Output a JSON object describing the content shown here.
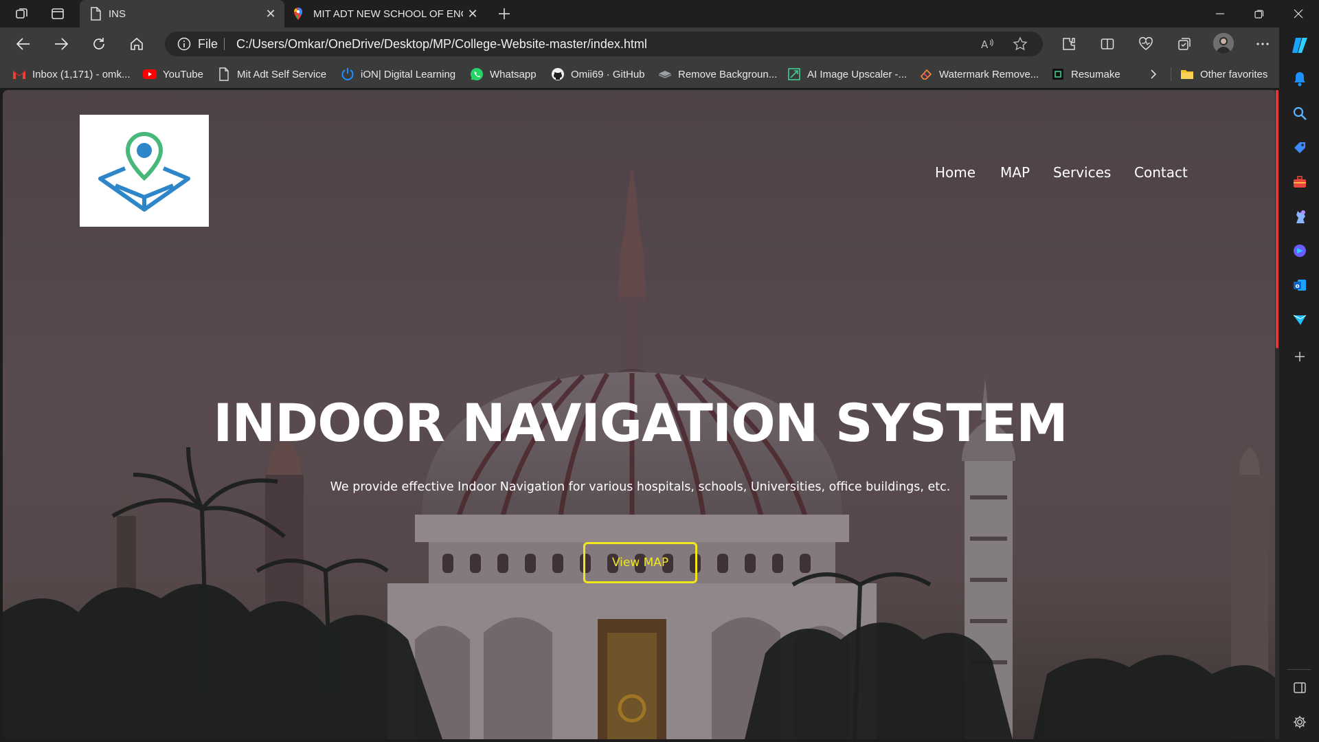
{
  "colors": {
    "accent_button": "#f2e71d",
    "scroll_thumb": "#e03b3b",
    "chrome_dark": "#1f1f1f",
    "chrome_mid": "#3b3b3b"
  },
  "tabs": [
    {
      "title": "INS",
      "icon": "document-icon",
      "active": true
    },
    {
      "title": "MIT ADT NEW SCHOOL OF ENGI",
      "icon": "map-pin-icon",
      "active": false
    }
  ],
  "address": {
    "scheme": "File",
    "url": "C:/Users/Omkar/OneDrive/Desktop/MP/College-Website-master/index.html"
  },
  "favorites": [
    {
      "label": "Inbox (1,171) - omk...",
      "icon": "gmail-icon"
    },
    {
      "label": "YouTube",
      "icon": "youtube-icon"
    },
    {
      "label": "Mit Adt Self Service",
      "icon": "document-icon"
    },
    {
      "label": "iON| Digital Learning",
      "icon": "ion-icon"
    },
    {
      "label": "Whatsapp",
      "icon": "whatsapp-icon"
    },
    {
      "label": "Omii69 · GitHub",
      "icon": "github-icon"
    },
    {
      "label": "Remove Backgroun...",
      "icon": "layers-icon"
    },
    {
      "label": "AI Image Upscaler -...",
      "icon": "upscale-icon"
    },
    {
      "label": "Watermark Remove...",
      "icon": "eraser-icon"
    },
    {
      "label": "Resumake",
      "icon": "resumake-icon"
    }
  ],
  "other_favorites": "Other favorites",
  "site": {
    "nav": [
      "Home",
      "MAP",
      "Services",
      "Contact"
    ],
    "hero_title": "INDOOR NAVIGATION SYSTEM",
    "hero_subtitle": "We provide effective Indoor Navigation for various hospitals, schools, Universities, office buildings, etc.",
    "cta_label": "View MAP",
    "logo_icon": "map-location-logo-icon"
  }
}
